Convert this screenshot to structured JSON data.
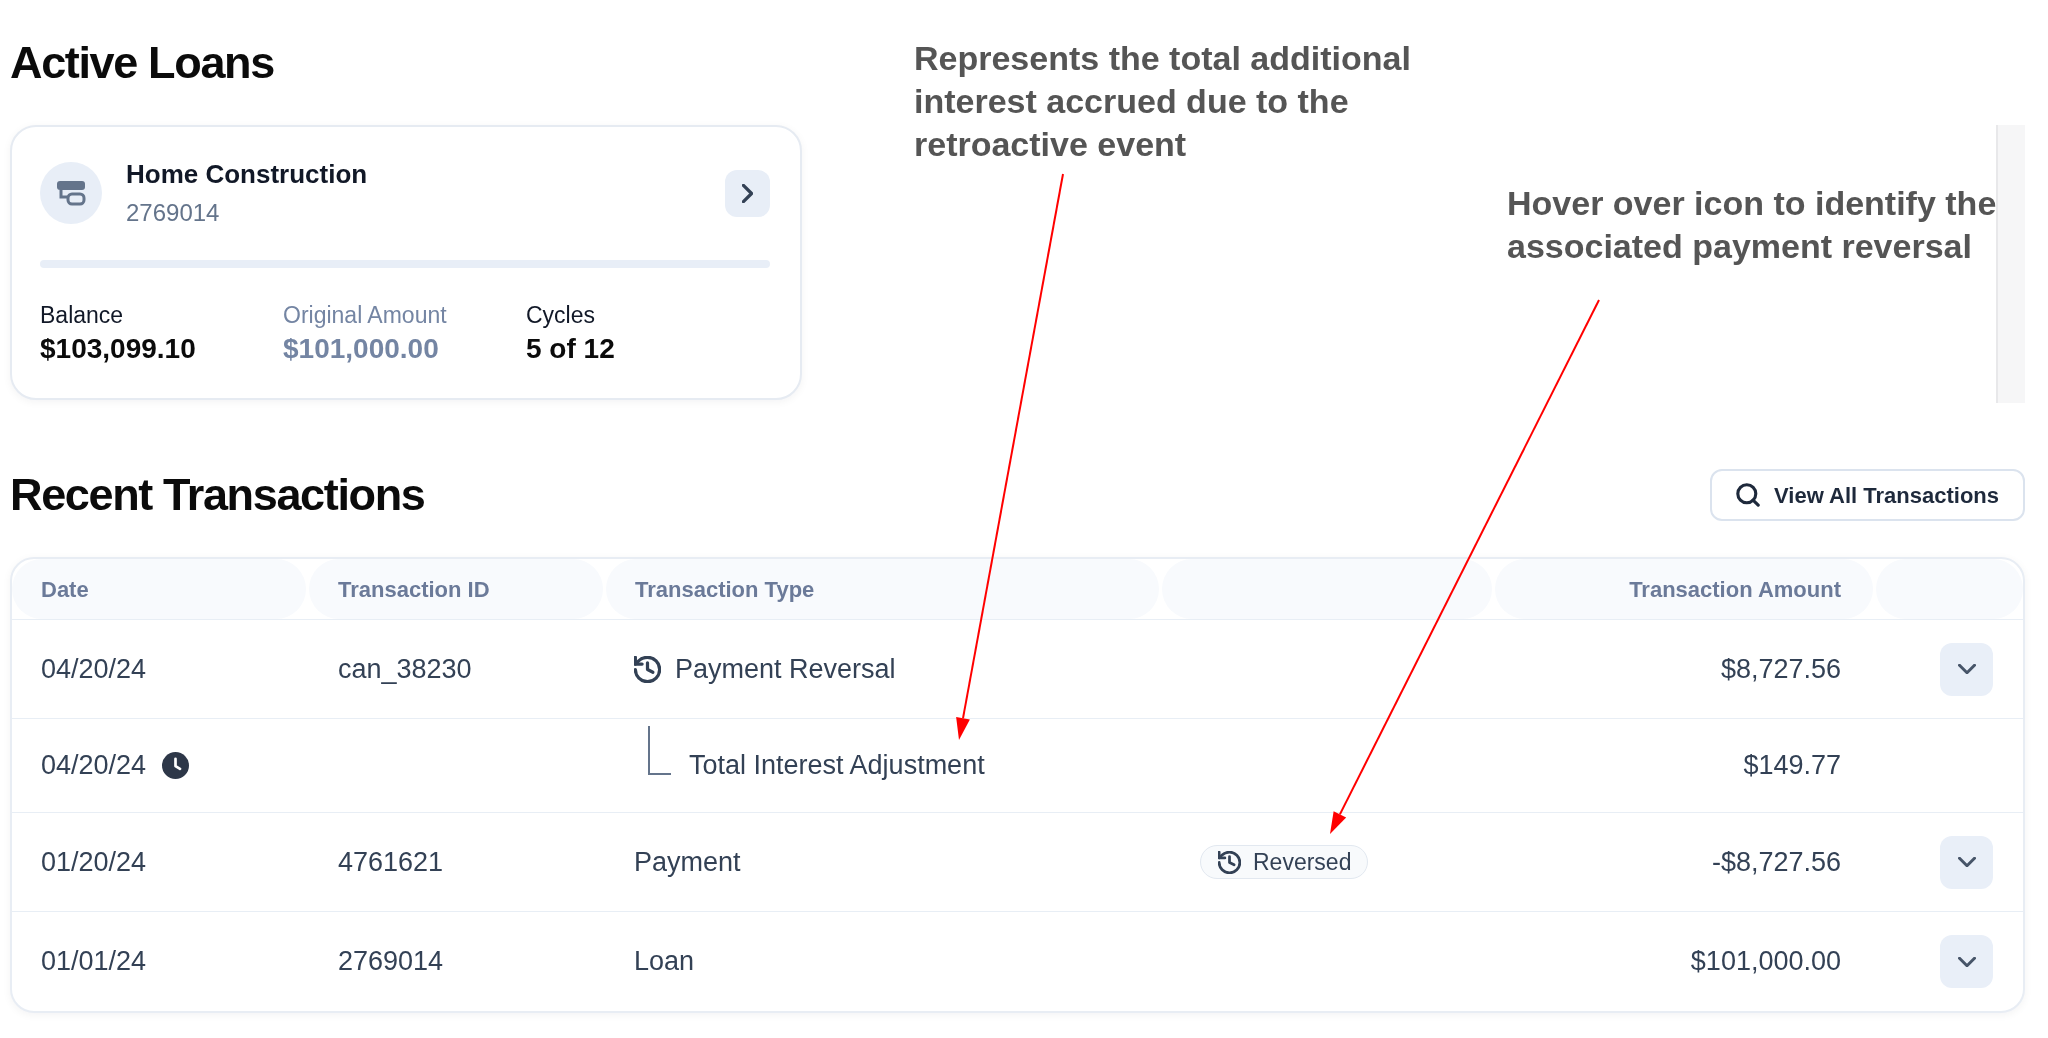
{
  "active_loans": {
    "title": "Active Loans",
    "loans": [
      {
        "name": "Home Construction",
        "loan_id": "2769014",
        "stats": [
          {
            "label": "Balance",
            "value": "$103,099.10",
            "muted": false
          },
          {
            "label": "Original Amount",
            "value": "$101,000.00",
            "muted": true
          },
          {
            "label": "Cycles",
            "value": "5 of 12",
            "muted": false
          }
        ]
      }
    ]
  },
  "annotations": [
    {
      "text": "Represents the total additional interest accrued due to the retroactive event"
    },
    {
      "text": "Hover over icon to identify the associated payment reversal"
    }
  ],
  "recent_transactions": {
    "title": "Recent Transactions",
    "view_all_button": "View All Transactions",
    "table": {
      "columns": [
        "Date",
        "Transaction ID",
        "Transaction Type",
        "Transaction Amount"
      ],
      "rows": [
        {
          "kind": "reversal",
          "date": "04/20/24",
          "transaction_id": "can_38230",
          "transaction_type": "Payment Reversal",
          "amount": "$8,727.56",
          "expanded": false
        },
        {
          "kind": "adjustment",
          "date": "04/20/24",
          "transaction_type": "Total Interest Adjustment",
          "amount": "$149.77"
        },
        {
          "kind": "transaction",
          "date": "01/20/24",
          "transaction_id": "4761621",
          "transaction_type": "Payment",
          "badge": "Reversed",
          "amount": "-$8,727.56",
          "expanded": false
        },
        {
          "kind": "transaction",
          "date": "01/01/24",
          "transaction_id": "2769014",
          "transaction_type": "Loan",
          "amount": "$101,000.00",
          "expanded": false
        }
      ]
    }
  }
}
